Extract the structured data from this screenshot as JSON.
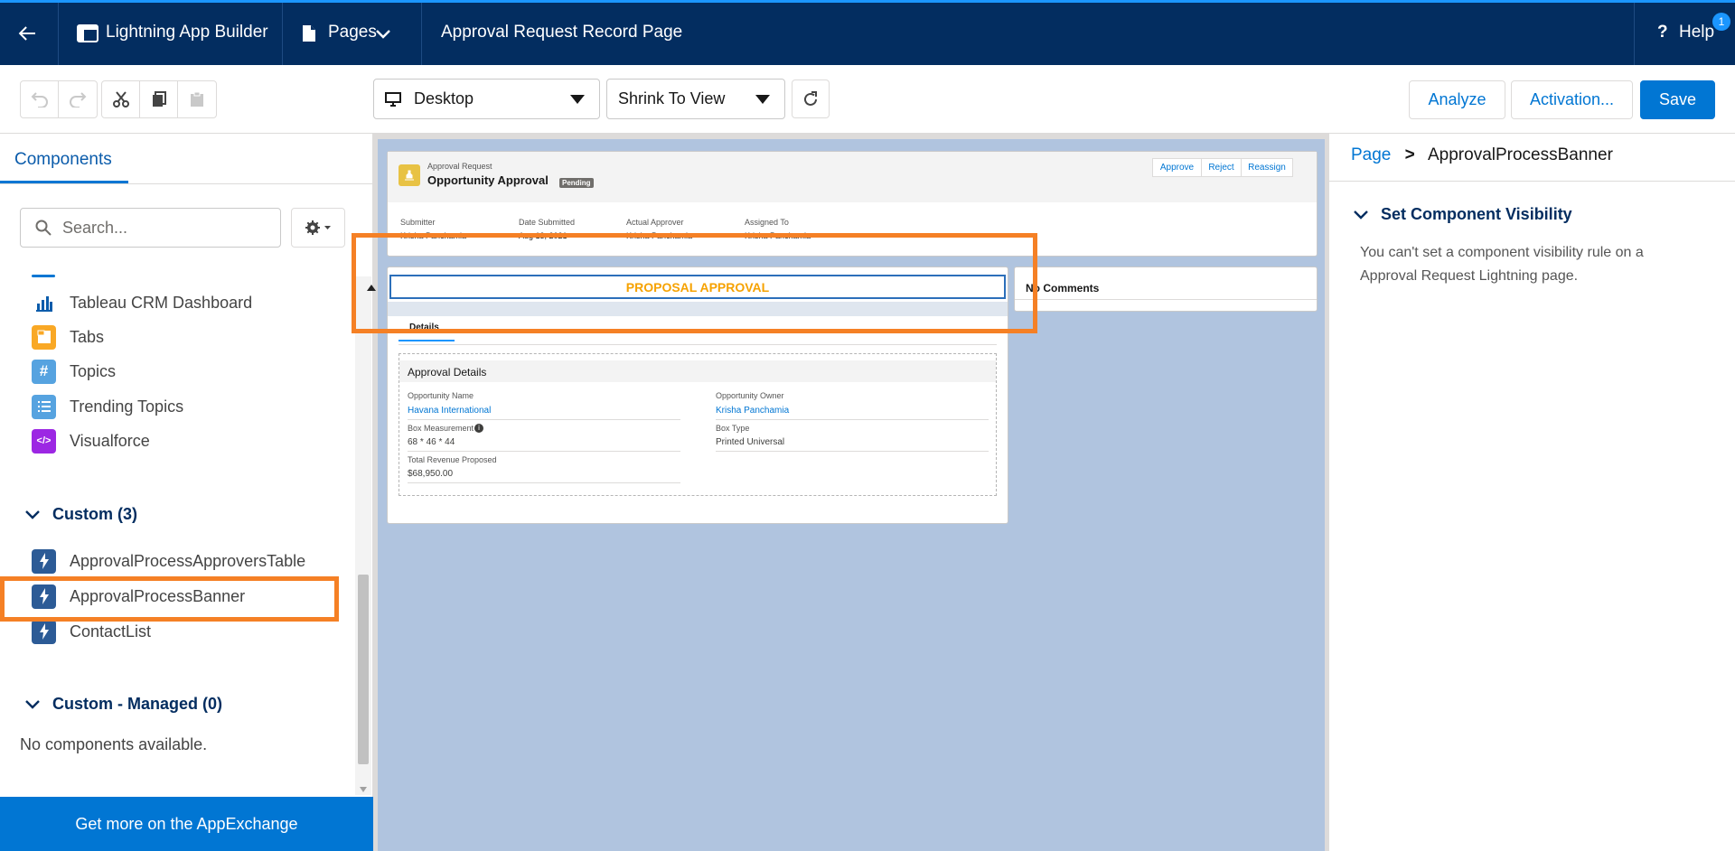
{
  "header": {
    "back_label": "back",
    "app_builder": "Lightning App Builder",
    "pages_menu": "Pages",
    "page_title": "Approval Request Record Page",
    "help": "Help",
    "help_badge": "1"
  },
  "toolbar": {
    "device": "Desktop",
    "zoom": "Shrink To View",
    "analyze": "Analyze",
    "activation": "Activation...",
    "save": "Save"
  },
  "left_panel": {
    "tab": "Components",
    "search_placeholder": "Search...",
    "items": [
      {
        "label": "Tableau CRM Dashboard",
        "icon": "chart-icon",
        "color": "#0b5cab"
      },
      {
        "label": "Tabs",
        "icon": "tabs-icon",
        "color": "#f9a825"
      },
      {
        "label": "Topics",
        "icon": "hash-icon",
        "color": "#56a3e0"
      },
      {
        "label": "Trending Topics",
        "icon": "list-icon",
        "color": "#56a3e0"
      },
      {
        "label": "Visualforce",
        "icon": "code-icon",
        "color": "#9c27e3"
      }
    ],
    "custom_header": "Custom (3)",
    "custom_items": [
      {
        "label": "ApprovalProcessApproversTable",
        "icon": "lightning-icon"
      },
      {
        "label": "ApprovalProcessBanner",
        "icon": "lightning-icon"
      },
      {
        "label": "ContactList",
        "icon": "lightning-icon"
      }
    ],
    "managed_header": "Custom - Managed (0)",
    "managed_empty": "No components available.",
    "appexchange": "Get more on the AppExchange"
  },
  "canvas": {
    "record_type": "Approval Request",
    "record_name": "Opportunity Approval",
    "status": "Pending",
    "actions": [
      "Approve",
      "Reject",
      "Reassign"
    ],
    "highlights": [
      {
        "label": "Submitter",
        "value": "Krisha Panchamia"
      },
      {
        "label": "Date Submitted",
        "value": "Aug 13, 2021"
      },
      {
        "label": "Actual Approver",
        "value": "Krisha Panchamia"
      },
      {
        "label": "Assigned To",
        "value": "Krisha Panchamia"
      }
    ],
    "banner": "PROPOSAL APPROVAL",
    "details_tab": "Details",
    "section_title": "Approval Details",
    "fields": {
      "opp_name_label": "Opportunity Name",
      "opp_name_value": "Havana International",
      "opp_owner_label": "Opportunity Owner",
      "opp_owner_value": "Krisha Panchamia",
      "box_meas_label": "Box Measurement",
      "box_meas_value": "68 * 46 * 44",
      "box_type_label": "Box Type",
      "box_type_value": "Printed Universal",
      "revenue_label": "Total Revenue Proposed",
      "revenue_value": "$68,950.00"
    },
    "comments": "No Comments"
  },
  "right_panel": {
    "breadcrumb_root": "Page",
    "breadcrumb_sep": ">",
    "breadcrumb_current": "ApprovalProcessBanner",
    "section": "Set Component Visibility",
    "message": "You can't set a component visibility rule on a Approval Request Lightning page."
  },
  "colors": {
    "nav": "#032d60",
    "brand": "#0176d3",
    "highlight": "#f58025",
    "banner_text": "#f6a200"
  }
}
